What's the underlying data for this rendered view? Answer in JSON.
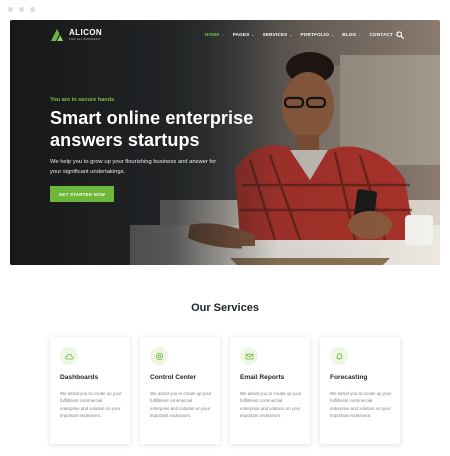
{
  "brand": {
    "name": "ALICON",
    "tagline": "FOR ALL BUSINESS",
    "accent": "#7cc242"
  },
  "nav": {
    "items": [
      {
        "label": "HOME",
        "caret": "⌄",
        "active": true
      },
      {
        "label": "PAGES",
        "caret": "⌄",
        "active": false
      },
      {
        "label": "SERVICES",
        "caret": "⌄",
        "active": false
      },
      {
        "label": "PORTFOLIO",
        "caret": "⌄",
        "active": false
      },
      {
        "label": "BLOG",
        "caret": "⌄",
        "active": false
      },
      {
        "label": "CONTACT",
        "caret": "⌄",
        "active": false
      }
    ],
    "search_icon": "search-icon"
  },
  "hero": {
    "eyebrow": "You are in secure hands",
    "headline": "Smart online enterprise answers startups",
    "subtext": "We help you to grow up your flourishing business and answer for your significant undertakings.",
    "cta": "GET STARTED NOW"
  },
  "services": {
    "title": "Our Services",
    "cards": [
      {
        "icon": "cloud-icon",
        "title": "Dashboards",
        "text": "We assist you to create up your fulfillment commercial enterprise and solution on your important endeavors."
      },
      {
        "icon": "gear-icon",
        "title": "Control Center",
        "text": "We assist you to create up your fulfillment commercial enterprise and solution on your important endeavors."
      },
      {
        "icon": "mail-icon",
        "title": "Email Reports",
        "text": "We assist you to create up your fulfillment commercial enterprise and solution on your important endeavors."
      },
      {
        "icon": "bell-icon",
        "title": "Forecasting",
        "text": "We assist you to create up your fulfillment commercial enterprise and solution on your important endeavors."
      }
    ]
  }
}
